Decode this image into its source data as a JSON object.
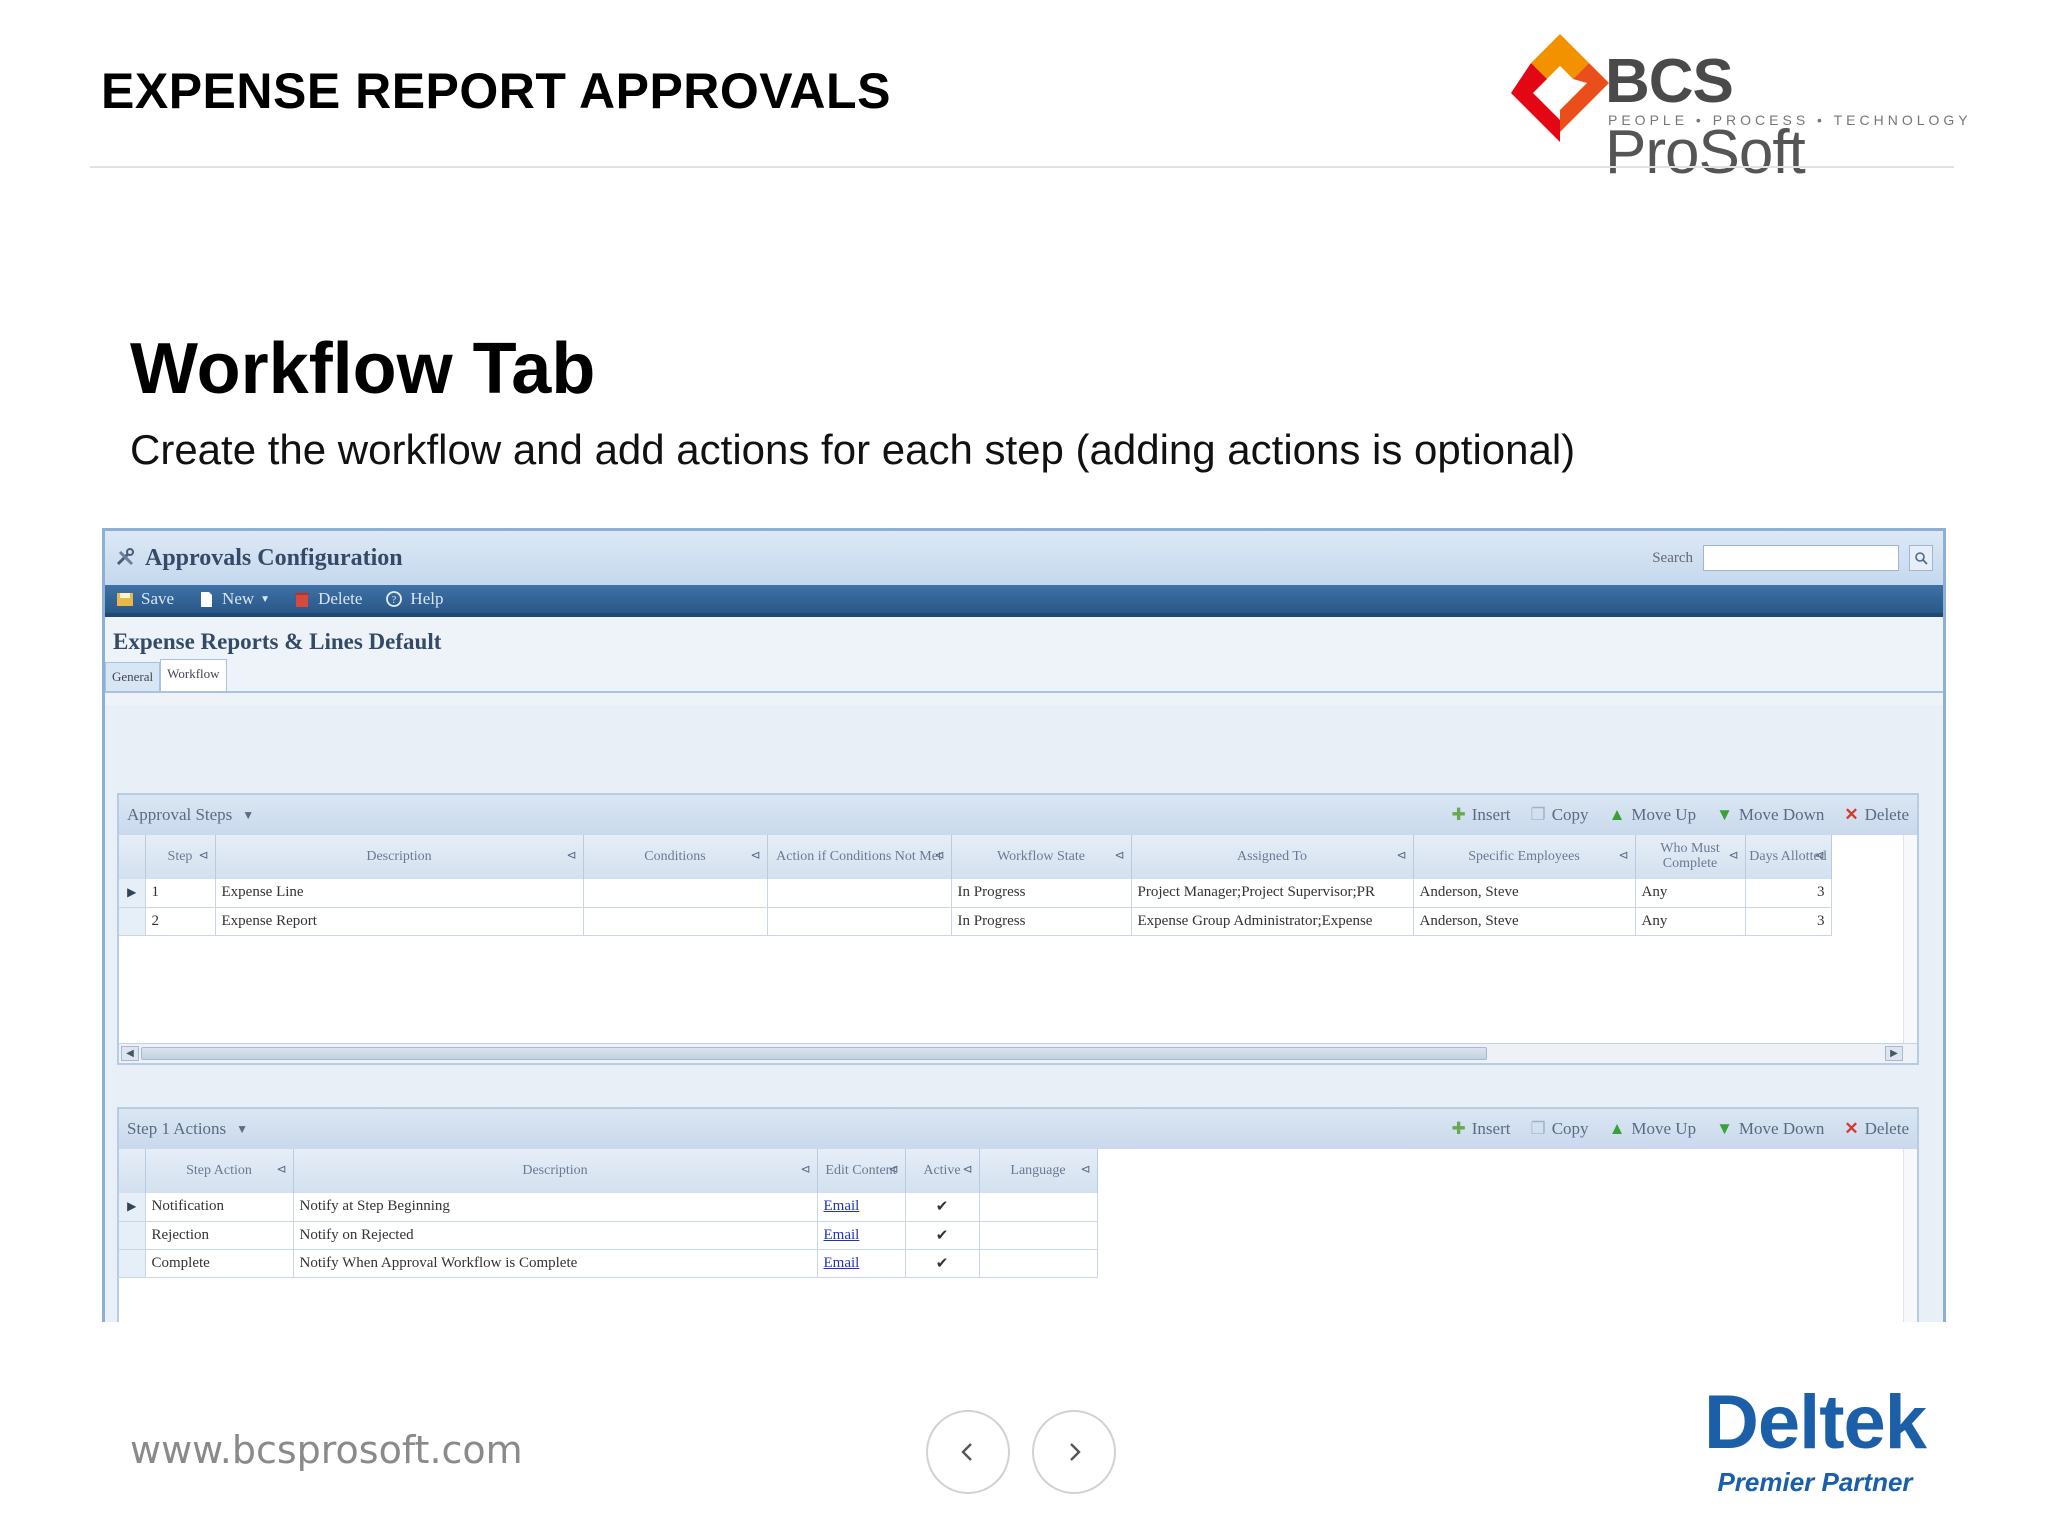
{
  "slide": {
    "header_title": "EXPENSE REPORT APPROVALS",
    "brand": {
      "name_bold": "BCS",
      "name_rest": " ProSoft",
      "tagline": "PEOPLE • PROCESS • TECHNOLOGY",
      "accent": "#e94e1b"
    },
    "section_title": "Workflow Tab",
    "section_subtitle": "Create the workflow and add actions for each step (adding actions is optional)",
    "footer_url": "www.bcsprosoft.com",
    "nav": {
      "prev_icon": "chevron-left-icon",
      "next_icon": "chevron-right-icon"
    },
    "partner": {
      "name": "Deltek",
      "tier": "Premier Partner",
      "color": "#1b5fa8"
    }
  },
  "app": {
    "title": "Approvals Configuration",
    "search_label": "Search",
    "search_value": "",
    "toolbar": {
      "save": "Save",
      "new": "New",
      "delete": "Delete",
      "help": "Help"
    },
    "record_title": "Expense Reports & Lines Default",
    "tabs": {
      "general": "General",
      "workflow": "Workflow"
    },
    "approval_steps": {
      "title": "Approval Steps",
      "tools": {
        "insert": "Insert",
        "copy": "Copy",
        "move_up": "Move Up",
        "move_down": "Move Down",
        "delete": "Delete"
      },
      "columns": {
        "step": "Step",
        "description": "Description",
        "conditions": "Conditions",
        "action_if_not_met": "Action if Conditions Not Met",
        "workflow_state": "Workflow State",
        "assigned_to": "Assigned To",
        "specific_employees": "Specific Employees",
        "who_must_complete": "Who Must Complete",
        "days_allotted": "Days Allotted"
      },
      "rows": [
        {
          "step": "1",
          "description": "Expense Line",
          "conditions": "",
          "action": "",
          "state": "In Progress",
          "assigned": "Project Manager;Project Supervisor;PR",
          "employees": "Anderson, Steve",
          "who": "Any",
          "days": "3"
        },
        {
          "step": "2",
          "description": "Expense Report",
          "conditions": "",
          "action": "",
          "state": "In Progress",
          "assigned": "Expense Group Administrator;Expense",
          "employees": "Anderson, Steve",
          "who": "Any",
          "days": "3"
        }
      ]
    },
    "step_actions": {
      "title": "Step 1 Actions",
      "tools": {
        "insert": "Insert",
        "copy": "Copy",
        "move_up": "Move Up",
        "move_down": "Move Down",
        "delete": "Delete"
      },
      "columns": {
        "step_action": "Step Action",
        "description": "Description",
        "edit_content": "Edit Content",
        "active": "Active",
        "language": "Language"
      },
      "rows": [
        {
          "action": "Notification",
          "description": "Notify at Step Beginning",
          "edit": "Email",
          "active": true,
          "language": ""
        },
        {
          "action": "Rejection",
          "description": "Notify on Rejected",
          "edit": "Email",
          "active": true,
          "language": ""
        },
        {
          "action": "Complete",
          "description": "Notify When Approval Workflow is Complete",
          "edit": "Email",
          "active": true,
          "language": ""
        }
      ]
    }
  }
}
